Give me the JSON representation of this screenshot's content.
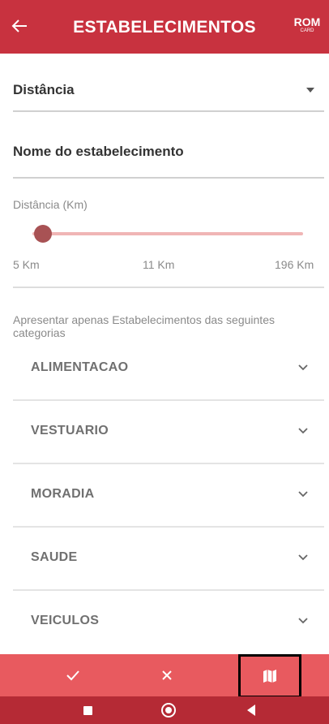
{
  "header": {
    "title": "ESTABELECIMENTOS",
    "logo_text": "ROM",
    "logo_subtext": "CARD"
  },
  "sort_dropdown": {
    "selected": "Distância"
  },
  "name_field": {
    "placeholder": "Nome do estabelecimento",
    "value": ""
  },
  "distance_filter": {
    "label": "Distância (Km)",
    "min_label": "5 Km",
    "mid_label": "11 Km",
    "max_label": "196 Km",
    "value_fraction": 0.0
  },
  "categories": {
    "intro": "Apresentar apenas Estabelecimentos das seguintes categorias",
    "items": [
      {
        "label": "ALIMENTACAO"
      },
      {
        "label": "VESTUARIO"
      },
      {
        "label": "MORADIA"
      },
      {
        "label": "SAUDE"
      },
      {
        "label": "VEICULOS"
      }
    ]
  },
  "actions": {
    "confirm_icon": "check-icon",
    "cancel_icon": "close-icon",
    "map_icon": "map-icon"
  },
  "system_nav": {
    "icons": [
      "recents-icon",
      "home-icon",
      "back-icon"
    ]
  },
  "colors": {
    "appbar": "#c8323f",
    "actionbar": "#e85a5f",
    "navbar": "#b52a35",
    "slider_thumb": "#a85254",
    "slider_track": "#f0b5b5"
  }
}
